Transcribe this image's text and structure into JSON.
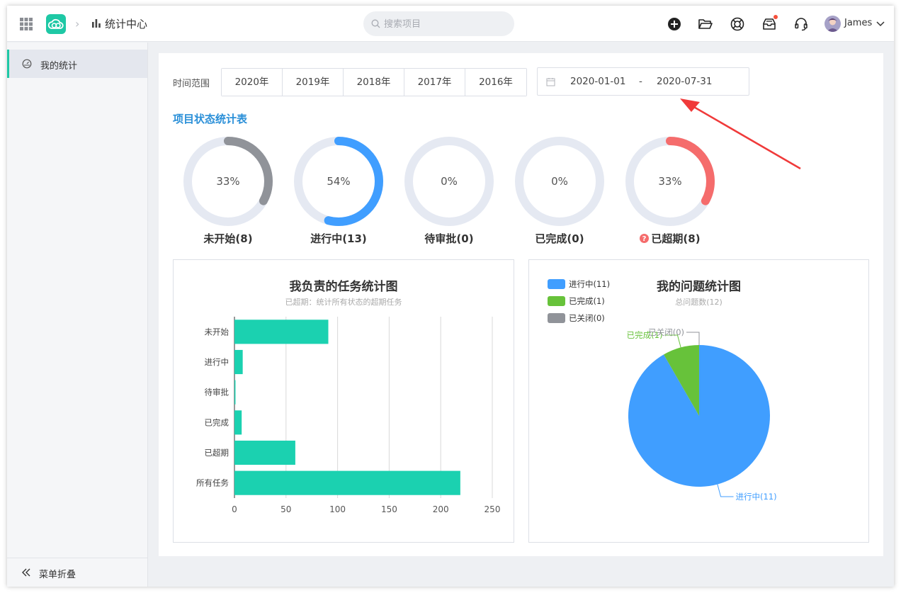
{
  "header": {
    "breadcrumb_title": "统计中心",
    "search_placeholder": "搜索项目",
    "user_name": "James"
  },
  "sidebar": {
    "items": [
      {
        "label": "我的统计"
      }
    ],
    "collapse_label": "菜单折叠"
  },
  "filter": {
    "range_label": "时间范围",
    "years": [
      "2020年",
      "2019年",
      "2018年",
      "2017年",
      "2016年"
    ],
    "date_start": "2020-01-01",
    "date_sep": "-",
    "date_end": "2020-07-31"
  },
  "status": {
    "title": "项目状态统计表",
    "rings": [
      {
        "label": "未开始(8)",
        "percent": 33,
        "percent_text": "33%",
        "color": "#909399",
        "warning": false
      },
      {
        "label": "进行中(13)",
        "percent": 54,
        "percent_text": "54%",
        "color": "#409eff",
        "warning": false
      },
      {
        "label": "待审批(0)",
        "percent": 0,
        "percent_text": "0%",
        "color": "#67c23a",
        "warning": false
      },
      {
        "label": "已完成(0)",
        "percent": 0,
        "percent_text": "0%",
        "color": "#67c23a",
        "warning": false
      },
      {
        "label": "已超期(8)",
        "percent": 33,
        "percent_text": "33%",
        "color": "#f56c6c",
        "warning": true
      }
    ],
    "track_color": "#e5e9f2"
  },
  "task_chart": {
    "title": "我负责的任务统计图",
    "subtitle": "已超期：统计所有状态的超期任务"
  },
  "issue_chart": {
    "title": "我的问题统计图",
    "subtitle": "总问题数(12)"
  },
  "chart_data": [
    {
      "type": "bar",
      "orientation": "horizontal",
      "title": "我负责的任务统计图",
      "subtitle": "已超期：统计所有状态的超期任务",
      "categories": [
        "未开始",
        "进行中",
        "待审批",
        "已完成",
        "已超期",
        "所有任务"
      ],
      "values": [
        91,
        8,
        1,
        7,
        59,
        219
      ],
      "xlim": [
        0,
        250
      ],
      "xticks": [
        "0",
        "50",
        "100",
        "150",
        "200",
        "250"
      ],
      "color": "#1bd1b0",
      "grid": true
    },
    {
      "type": "pie",
      "title": "我的问题统计图",
      "subtitle": "总问题数(12)",
      "slices": [
        {
          "name": "进行中(11)",
          "value": 11,
          "color": "#409eff"
        },
        {
          "name": "已完成(1)",
          "value": 1,
          "color": "#67c23a"
        },
        {
          "name": "已关闭(0)",
          "value": 0,
          "color": "#909399"
        }
      ],
      "legend_position": "top-left"
    }
  ]
}
